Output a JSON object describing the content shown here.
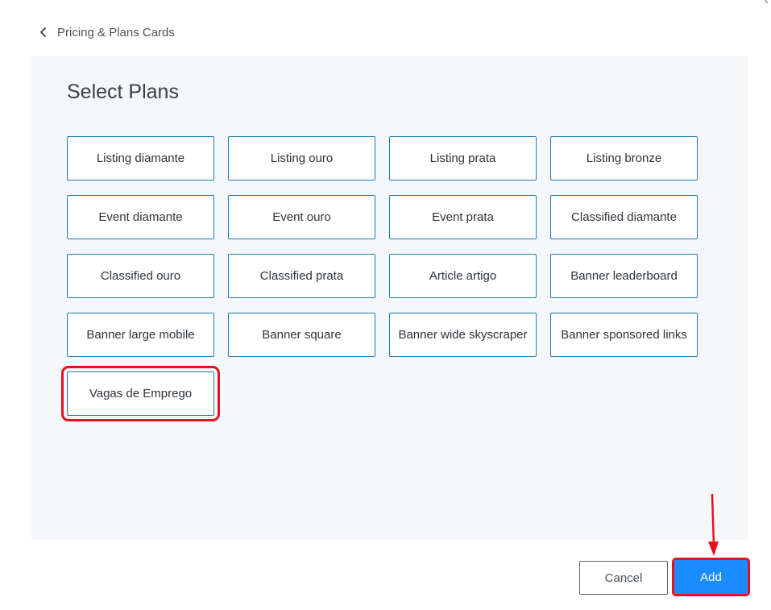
{
  "breadcrumb": {
    "back_icon": "chevron-left-icon",
    "label": "Pricing & Plans Cards"
  },
  "panel": {
    "title": "Select Plans",
    "plans": [
      "Listing diamante",
      "Listing ouro",
      "Listing prata",
      "Listing bronze",
      "Event diamante",
      "Event ouro",
      "Event prata",
      "Classified diamante",
      "Classified ouro",
      "Classified prata",
      "Article artigo",
      "Banner leaderboard",
      "Banner large mobile",
      "Banner square",
      "Banner wide skyscraper",
      "Banner sponsored links",
      "Vagas de Emprego"
    ]
  },
  "footer": {
    "cancel_label": "Cancel",
    "add_label": "Add"
  },
  "annotations": {
    "highlight_color": "#e8101f",
    "arrow_icon": "arrow-down-icon"
  },
  "colors": {
    "panel_bg": "#f5f7fa",
    "card_border": "#1b7ab3",
    "primary": "#1a8cff"
  }
}
